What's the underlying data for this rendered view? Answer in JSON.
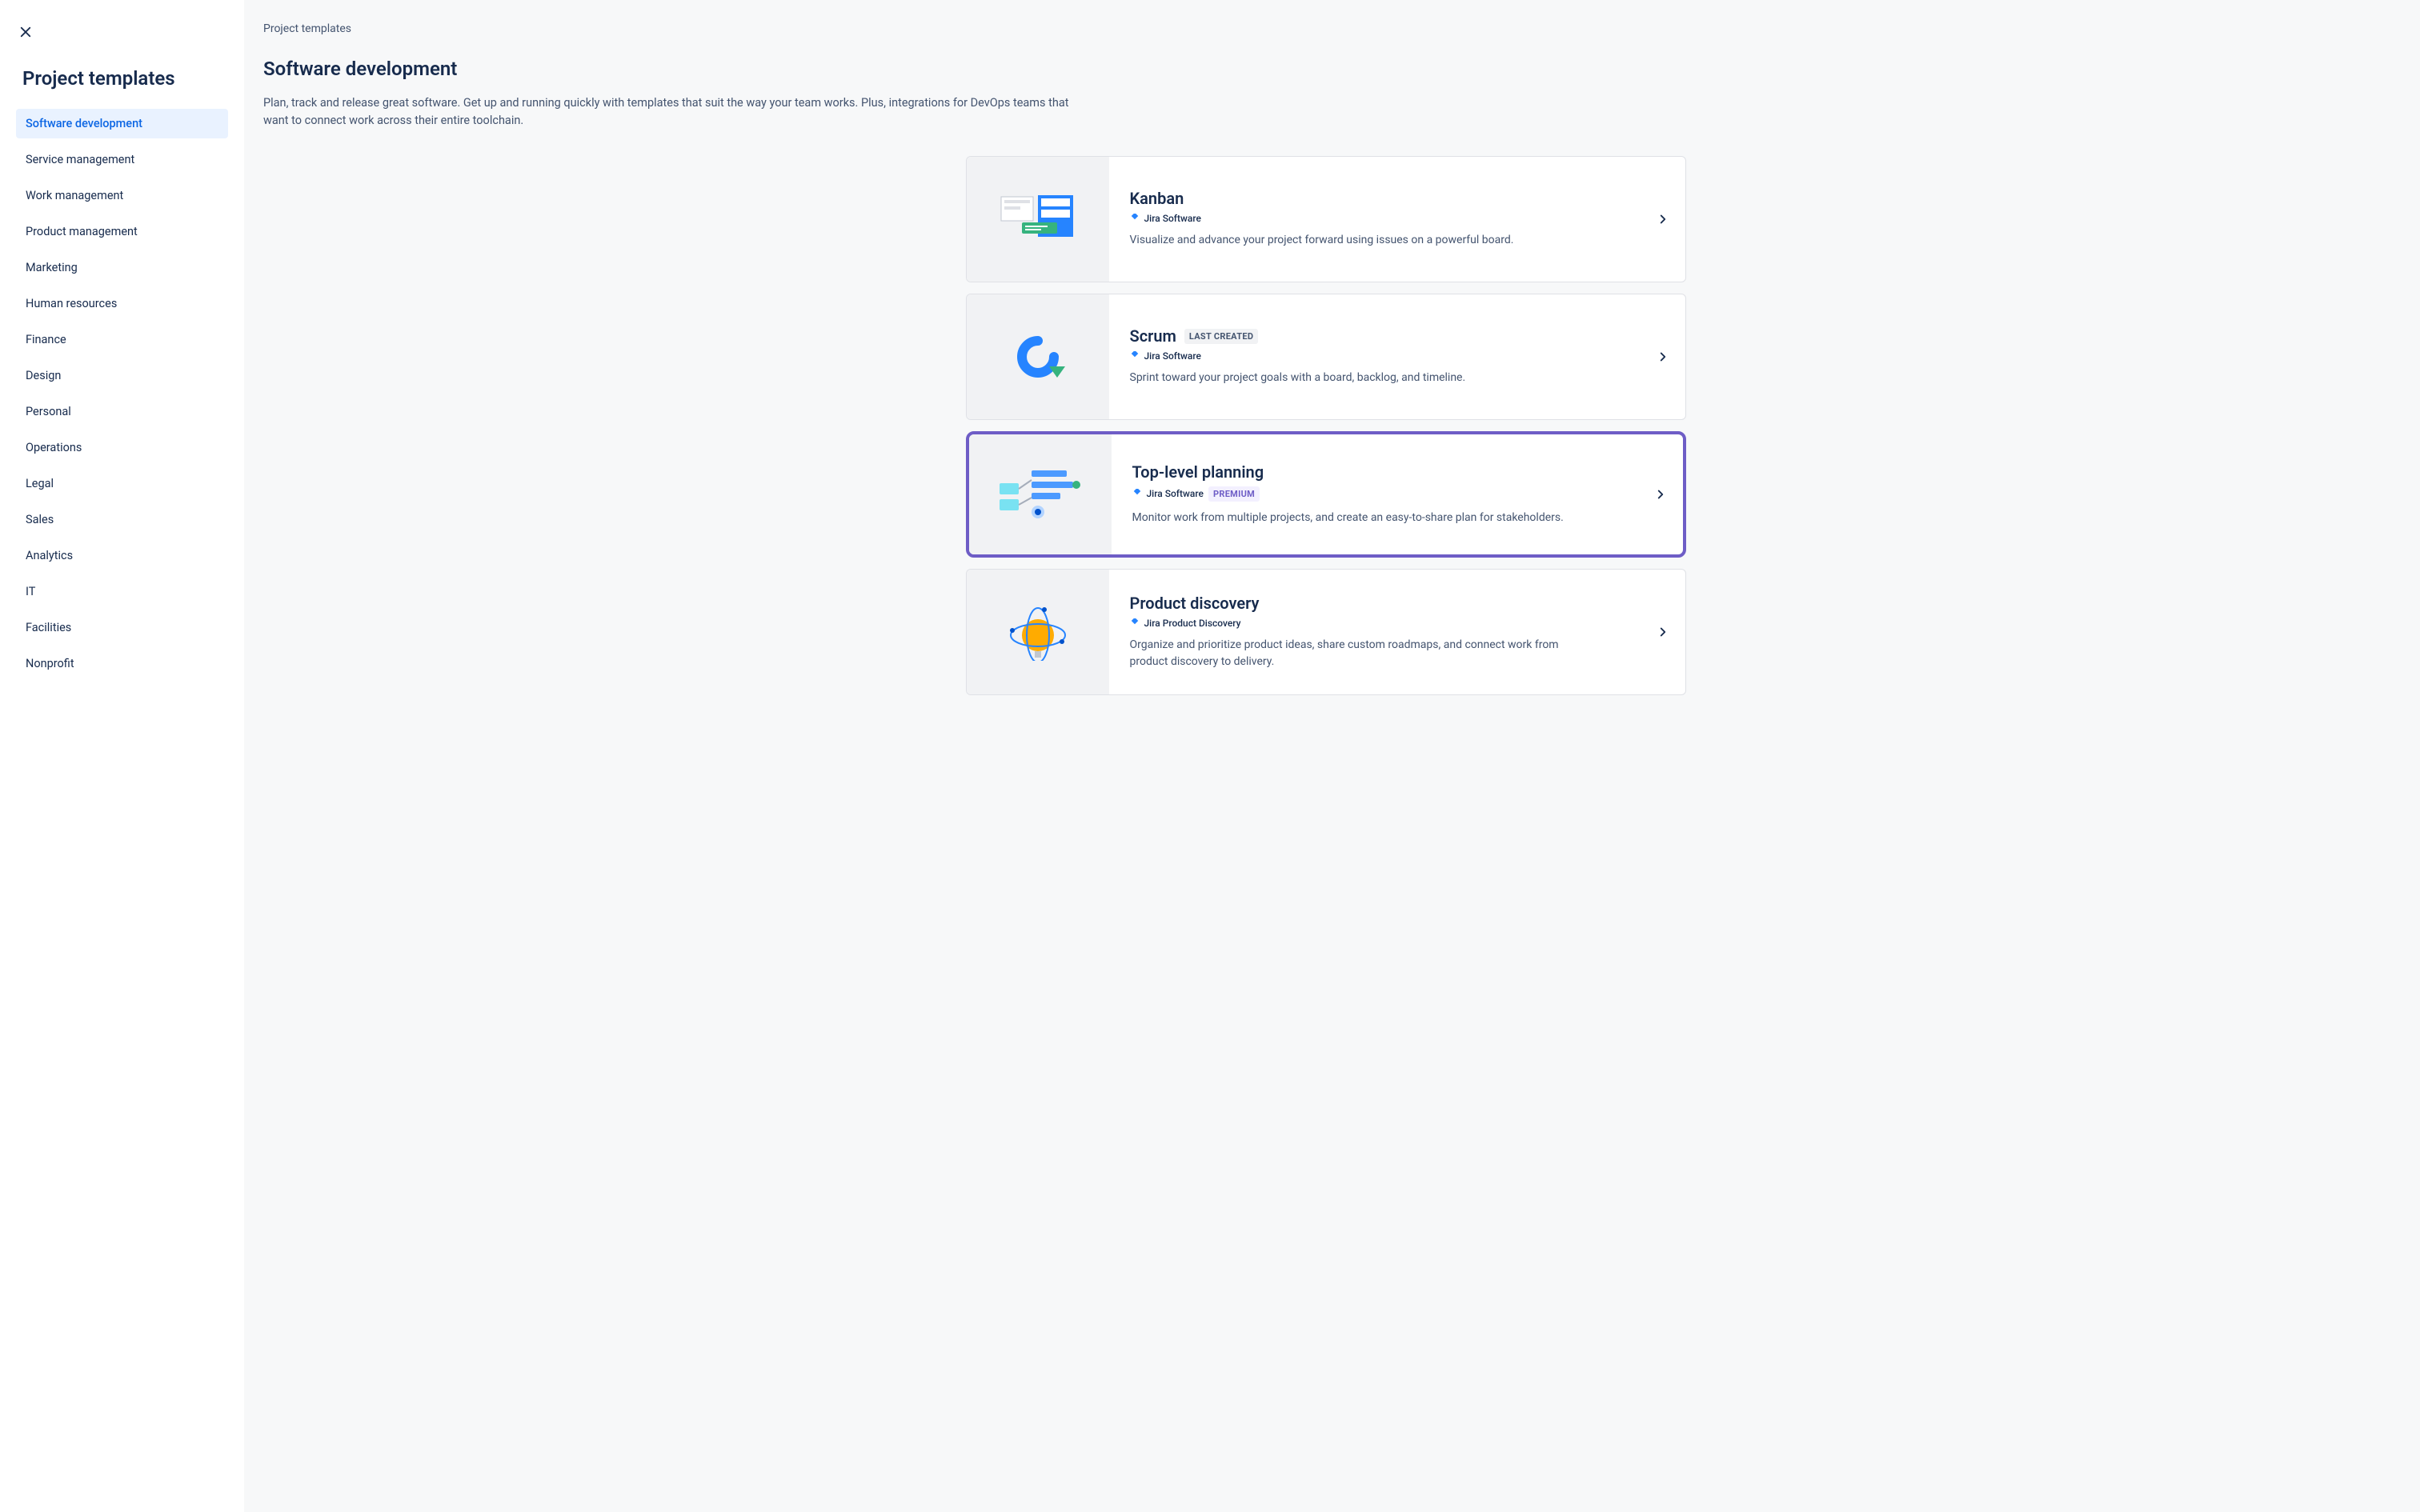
{
  "sidebar": {
    "title": "Project templates",
    "items": [
      {
        "label": "Software development",
        "active": true
      },
      {
        "label": "Service management",
        "active": false
      },
      {
        "label": "Work management",
        "active": false
      },
      {
        "label": "Product management",
        "active": false
      },
      {
        "label": "Marketing",
        "active": false
      },
      {
        "label": "Human resources",
        "active": false
      },
      {
        "label": "Finance",
        "active": false
      },
      {
        "label": "Design",
        "active": false
      },
      {
        "label": "Personal",
        "active": false
      },
      {
        "label": "Operations",
        "active": false
      },
      {
        "label": "Legal",
        "active": false
      },
      {
        "label": "Sales",
        "active": false
      },
      {
        "label": "Analytics",
        "active": false
      },
      {
        "label": "IT",
        "active": false
      },
      {
        "label": "Facilities",
        "active": false
      },
      {
        "label": "Nonprofit",
        "active": false
      }
    ]
  },
  "main": {
    "breadcrumb": "Project templates",
    "title": "Software development",
    "description": "Plan, track and release great software. Get up and running quickly with templates that suit the way your team works. Plus, integrations for DevOps teams that want to connect work across their entire toolchain.",
    "cards": [
      {
        "title": "Kanban",
        "product": "Jira Software",
        "badge": null,
        "premium": false,
        "description": "Visualize and advance your project forward using issues on a powerful board.",
        "highlighted": false
      },
      {
        "title": "Scrum",
        "product": "Jira Software",
        "badge": "LAST CREATED",
        "premium": false,
        "description": "Sprint toward your project goals with a board, backlog, and timeline.",
        "highlighted": false
      },
      {
        "title": "Top-level planning",
        "product": "Jira Software",
        "badge": null,
        "premium": true,
        "premium_label": "PREMIUM",
        "description": "Monitor work from multiple projects, and create an easy-to-share plan for stakeholders.",
        "highlighted": true
      },
      {
        "title": "Product discovery",
        "product": "Jira Product Discovery",
        "badge": null,
        "premium": false,
        "description": "Organize and prioritize product ideas, share custom roadmaps, and connect work from product discovery to delivery.",
        "highlighted": false
      }
    ]
  },
  "colors": {
    "accent": "#0c66e4",
    "highlight_border": "#6e5dc6"
  }
}
